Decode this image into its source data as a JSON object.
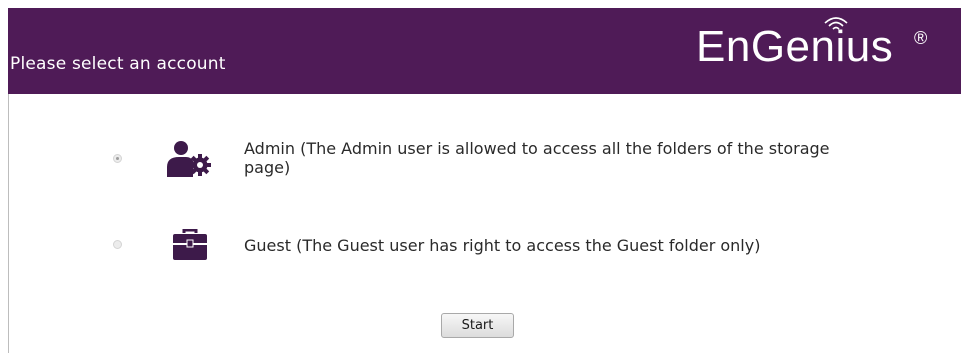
{
  "header": {
    "title": "Please select an account",
    "logo_text": "EnGenius",
    "logo_mark": "®",
    "background": "#4f1b57"
  },
  "accounts": [
    {
      "label_line1": "Admin (The Admin user is allowed to access all the folders of the storage",
      "label_line2": "page)",
      "icon": "admin-gear-icon",
      "selected": true
    },
    {
      "label_line1": "Guest (The Guest user has right to access the Guest folder only)",
      "icon": "briefcase-icon",
      "selected": false
    }
  ],
  "actions": {
    "start_label": "Start"
  },
  "colors": {
    "accent": "#4f1b57",
    "icon": "#3d1a4a"
  }
}
